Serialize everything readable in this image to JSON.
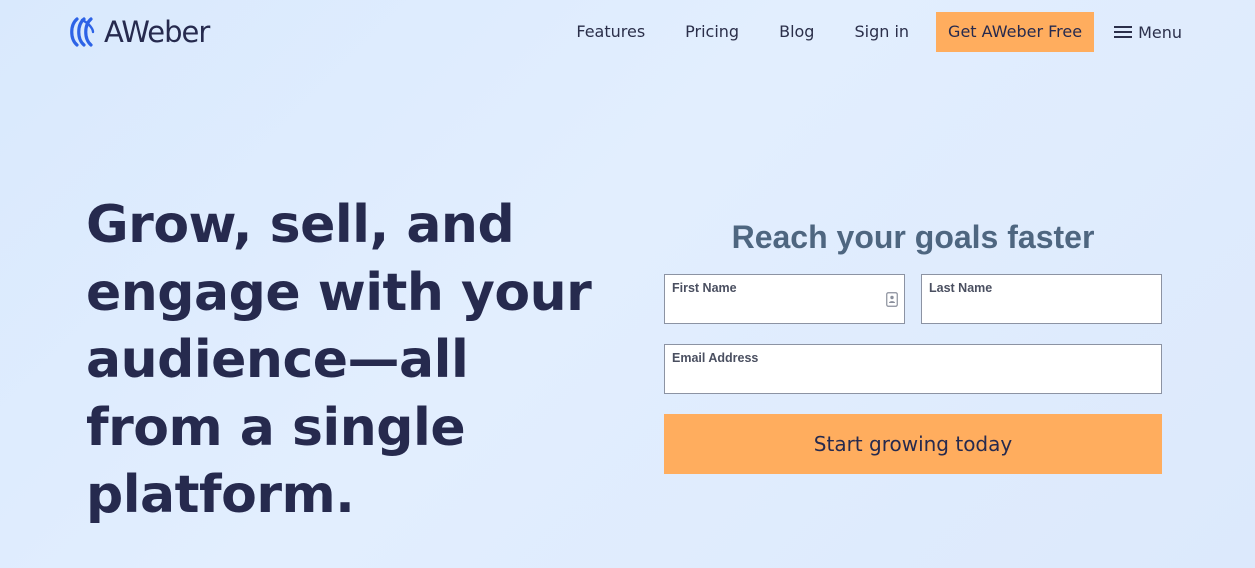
{
  "brand": {
    "name": "AWeber",
    "accent": "#ffad5e",
    "logo_blue": "#2d63e6"
  },
  "nav": {
    "links": [
      "Features",
      "Pricing",
      "Blog",
      "Sign in"
    ],
    "cta": "Get AWeber Free",
    "menu": "Menu"
  },
  "hero": {
    "headline_lines": [
      "Grow, sell, and",
      "engage with your",
      "audience—all",
      "from a single",
      "platform."
    ]
  },
  "form": {
    "title": "Reach your goals faster",
    "first_name": {
      "label": "First Name",
      "value": ""
    },
    "last_name": {
      "label": "Last Name",
      "value": ""
    },
    "email": {
      "label": "Email Address",
      "value": ""
    },
    "submit": "Start growing today"
  }
}
